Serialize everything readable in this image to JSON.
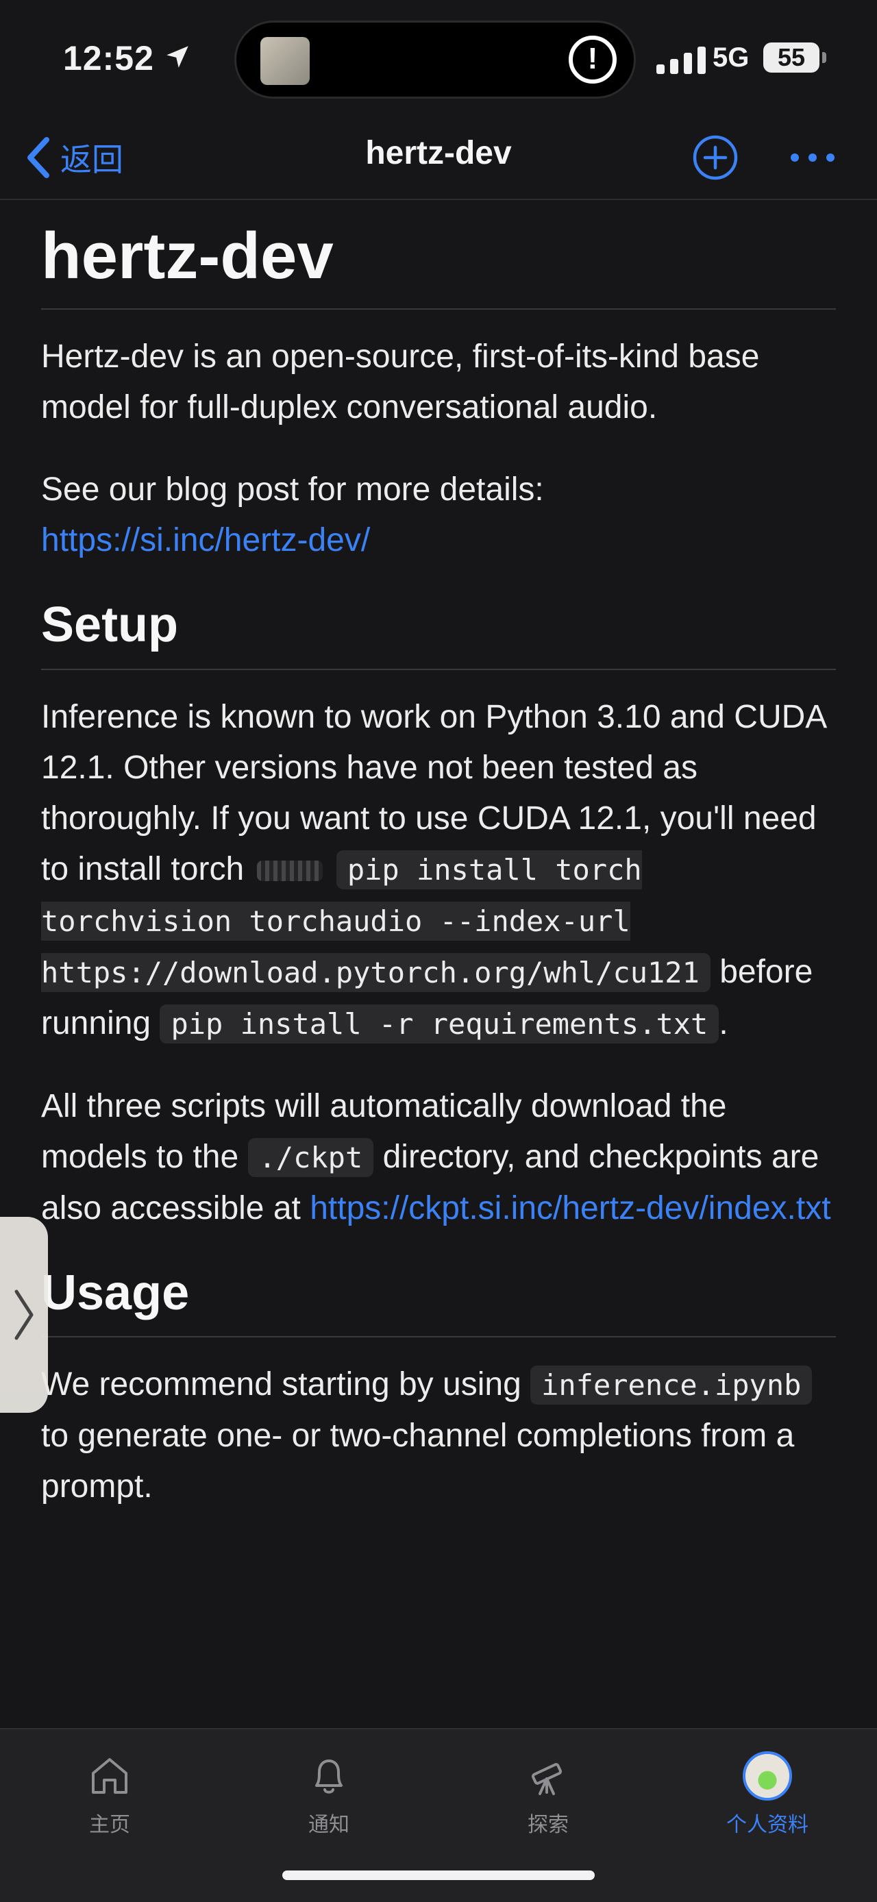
{
  "status": {
    "time": "12:52",
    "network": "5G",
    "battery": "55",
    "alert_glyph": "!"
  },
  "nav": {
    "back_label": "返回",
    "title": "hertz-dev",
    "icons": [
      "chevron-left-icon",
      "add-circle-icon",
      "more-dots-icon"
    ]
  },
  "readme": {
    "title": "hertz-dev",
    "intro": "Hertz-dev is an open-source, first-of-its-kind base model for full-duplex conversational audio.",
    "blog_text": "See our blog post for more details:",
    "blog_link": "https://si.inc/hertz-dev/",
    "setup_heading": "Setup",
    "setup_text_1": "Inference is known to work on Python 3.10 and CUDA 12.1. Other versions have not been tested as thoroughly. If you want to use CUDA 12.1, you'll need to install torch",
    "setup_code_1": "pip install torch torchvision torchaudio --index-url https://download.pytorch.org/whl/cu121",
    "setup_text_2": "before running",
    "setup_code_2": "pip install -r requirements.txt",
    "setup_text_3": ".",
    "scripts_text_1": "All three scripts will automatically download the models to the",
    "scripts_code": "./ckpt",
    "scripts_text_2": "directory, and checkpoints are also accessible at",
    "scripts_link": "https://ckpt.si.inc/hertz-dev/index.txt",
    "usage_heading": "Usage",
    "usage_text_1": "We recommend starting by using",
    "usage_code": "inference.ipynb",
    "usage_text_2": "to generate one- or two-channel completions from a prompt."
  },
  "tabs": [
    {
      "label": "主页",
      "icon": "home-icon",
      "active": false
    },
    {
      "label": "通知",
      "icon": "bell-icon",
      "active": false
    },
    {
      "label": "探索",
      "icon": "telescope-icon",
      "active": false
    },
    {
      "label": "个人资料",
      "icon": "avatar",
      "active": true
    }
  ],
  "colors": {
    "background": "#161618",
    "accent": "#3b82f6",
    "text": "#f2f2f2",
    "code_bg": "#2a2a2d"
  }
}
